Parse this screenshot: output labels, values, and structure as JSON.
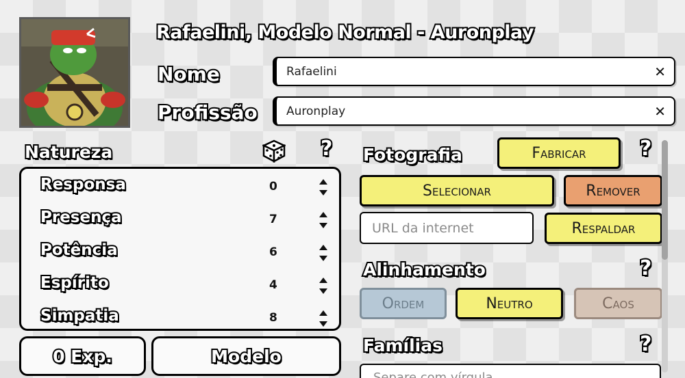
{
  "header": {
    "title": "Rafaelini, Modelo Normal - Auronplay"
  },
  "fields": {
    "nome_label": "Nome",
    "nome_value": "Rafaelini",
    "profissao_label": "Profissão",
    "profissao_value": "Auronplay",
    "clear_glyph": "✕"
  },
  "natureza": {
    "label": "Natureza",
    "help": "?",
    "stats": [
      {
        "name": "Responsa",
        "value": "0"
      },
      {
        "name": "Presença",
        "value": "7"
      },
      {
        "name": "Potência",
        "value": "6"
      },
      {
        "name": "Espírito",
        "value": "4"
      },
      {
        "name": "Simpatia",
        "value": "8"
      }
    ]
  },
  "bottom": {
    "exp_label": "0 Exp.",
    "modelo_label": "Modelo"
  },
  "fotografia": {
    "label": "Fotografia",
    "help": "?",
    "fabricar": "Fabricar",
    "selecionar": "Selecionar",
    "remover": "Remover",
    "url_placeholder": "URL da internet",
    "respaldar": "Respaldar"
  },
  "alinhamento": {
    "label": "Alinhamento",
    "help": "?",
    "ordem": "Ordem",
    "neutro": "Neutro",
    "caos": "Caos"
  },
  "familias": {
    "label": "Famílias",
    "help": "?",
    "placeholder": "Separe com vírgula"
  },
  "colors": {
    "yellow": "#f4f07a",
    "orange": "#e9a070",
    "ordem_disabled": "#b6c8d6",
    "caos_disabled": "#d6c4b6"
  },
  "icons": [
    "dice-icon",
    "clear-icon",
    "spinner-icon",
    "help-icon"
  ]
}
